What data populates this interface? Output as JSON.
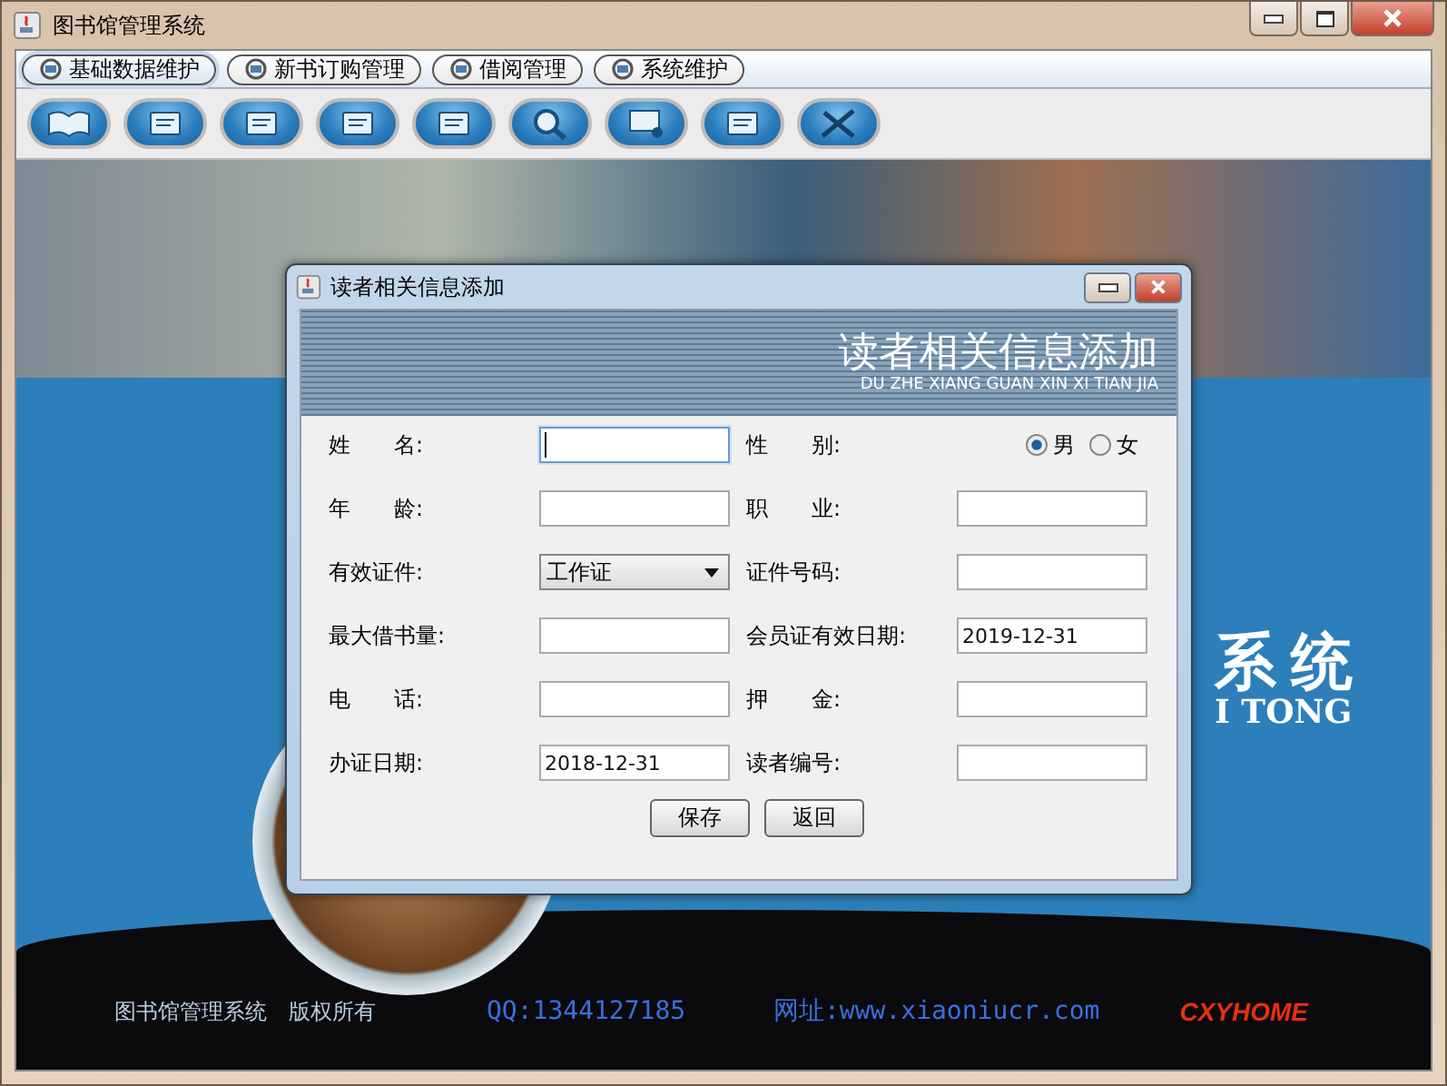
{
  "window": {
    "title": "图书馆管理系统"
  },
  "menu": [
    {
      "label": "基础数据维护",
      "selected": true
    },
    {
      "label": "新书订购管理",
      "selected": false
    },
    {
      "label": "借阅管理",
      "selected": false
    },
    {
      "label": "系统维护",
      "selected": false
    }
  ],
  "background": {
    "title": "系统",
    "subtitle": "I TONG"
  },
  "footer": {
    "copyright": "图书馆管理系统　版权所有",
    "qq": "QQ:1344127185",
    "site": "网址:www.xiaoniucr.com",
    "logo": "CXYHOME"
  },
  "dialog": {
    "title": "读者相关信息添加",
    "banner": {
      "title": "读者相关信息添加",
      "pinyin": "DU ZHE XIANG GUAN XIN XI TIAN JIA"
    },
    "fields": [
      {
        "label": "姓　　名:",
        "kind": "text",
        "focused": true
      },
      {
        "label": "性　　别:",
        "kind": "radio",
        "options": [
          {
            "label": "男",
            "selected": true
          },
          {
            "label": "女",
            "selected": false
          }
        ]
      },
      {
        "label": "年　　龄:",
        "kind": "text",
        "focused": false
      },
      {
        "label": "职　　业:",
        "kind": "text",
        "focused": false
      },
      {
        "label": "有效证件:",
        "kind": "select",
        "value": "工作证"
      },
      {
        "label": "证件号码:",
        "kind": "text",
        "focused": false
      },
      {
        "label": "最大借书量:",
        "kind": "text",
        "focused": false
      },
      {
        "label": "会员证有效日期:",
        "kind": "text",
        "value": "2019-12-31",
        "focused": false
      },
      {
        "label": "电　　话:",
        "kind": "text",
        "focused": false
      },
      {
        "label": "押　　金:",
        "kind": "text",
        "focused": false
      },
      {
        "label": "办证日期:",
        "kind": "text",
        "value": "2018-12-31",
        "focused": false
      },
      {
        "label": "读者编号:",
        "kind": "text",
        "focused": false
      }
    ],
    "buttons": [
      "保存",
      "返回"
    ]
  }
}
